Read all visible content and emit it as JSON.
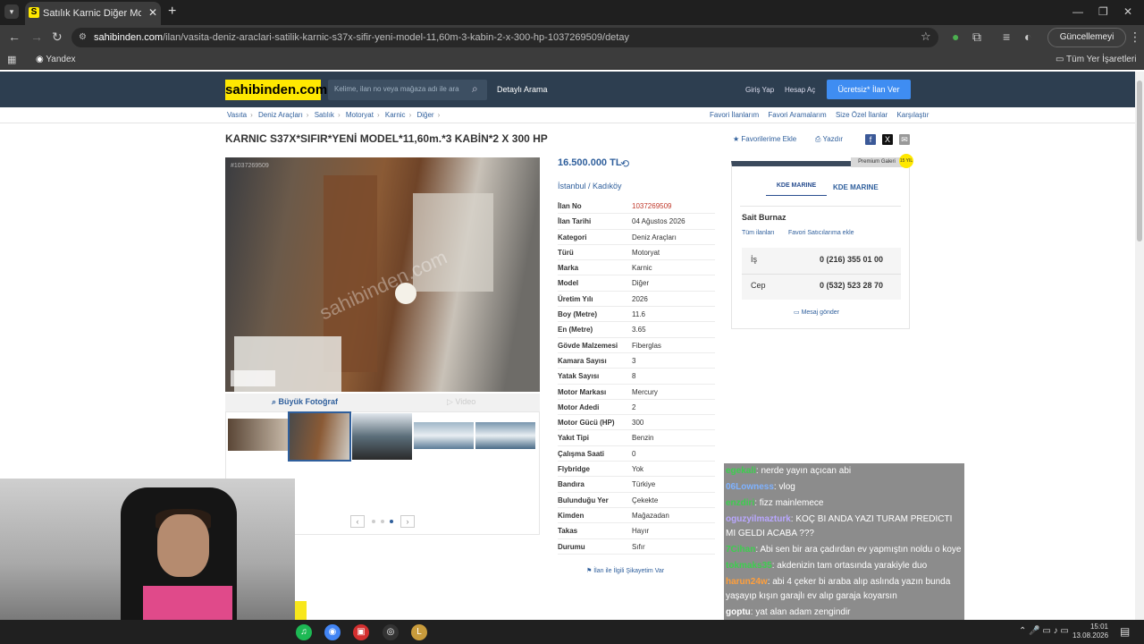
{
  "browser": {
    "tab_title": "Satılık Karnic Diğer Motoryat -",
    "tab_close": "✕",
    "new_tab": "+",
    "url_domain": "sahibinden.com",
    "url_path": "/ilan/vasita-deniz-araclari-satilik-karnic-s37x-sifir-yeni-model-11,60m-3-kabin-2-x-300-hp-1037269509/detay",
    "update_button": "Güncellemeyi tamamla",
    "bookmark_left": "Yandex",
    "bookmark_right": "Tüm Yer İşaretleri"
  },
  "site": {
    "logo": "sahibinden.com",
    "search_placeholder": "Kelime, ilan no veya mağaza adı ile ara",
    "detailed_search": "Detaylı Arama",
    "login": "Giriş Yap",
    "register": "Hesap Aç",
    "post_ad": "Ücretsiz* İlan Ver"
  },
  "breadcrumb": [
    "Vasıta",
    "Deniz Araçları",
    "Satılık",
    "Motoryat",
    "Karnic",
    "Diğer"
  ],
  "top_links": [
    "Favori İlanlarım",
    "Favori Aramalarım",
    "Size Özel İlanlar",
    "Karşılaştır"
  ],
  "listing": {
    "title": "KARNIC S37X*SIFIR*YENİ MODEL*11,60m.*3 KABİN*2 X 300 HP",
    "add_favorite": "Favorilerime Ekle",
    "print": "Yazdır",
    "price": "16.500.000 TL",
    "location": "İstanbul  /  Kadıköy",
    "big_photo": "Büyük Fotoğraf",
    "video": "Video",
    "photo_watermark": "sahibinden.com",
    "photo_id": "#1037269509",
    "complaint": "İlan ile İlgili Şikayetim Var",
    "details": [
      {
        "k": "İlan No",
        "v": "1037269509",
        "red": true
      },
      {
        "k": "İlan Tarihi",
        "v": "04 Ağustos 2026"
      },
      {
        "k": "Kategori",
        "v": "Deniz Araçları"
      },
      {
        "k": "Türü",
        "v": "Motoryat"
      },
      {
        "k": "Marka",
        "v": "Karnic"
      },
      {
        "k": "Model",
        "v": "Diğer"
      },
      {
        "k": "Üretim Yılı",
        "v": "2026"
      },
      {
        "k": "Boy (Metre)",
        "v": "11.6"
      },
      {
        "k": "En (Metre)",
        "v": "3.65"
      },
      {
        "k": "Gövde Malzemesi",
        "v": "Fiberglas"
      },
      {
        "k": "Kamara Sayısı",
        "v": "3"
      },
      {
        "k": "Yatak Sayısı",
        "v": "8"
      },
      {
        "k": "Motor Markası",
        "v": "Mercury"
      },
      {
        "k": "Motor Adedi",
        "v": "2"
      },
      {
        "k": "Motor Gücü (HP)",
        "v": "300"
      },
      {
        "k": "Yakıt Tipi",
        "v": "Benzin"
      },
      {
        "k": "Çalışma Saati",
        "v": "0"
      },
      {
        "k": "Flybridge",
        "v": "Yok"
      },
      {
        "k": "Bandıra",
        "v": "Türkiye"
      },
      {
        "k": "Bulunduğu Yer",
        "v": "Çekekte"
      },
      {
        "k": "Kimden",
        "v": "Mağazadan"
      },
      {
        "k": "Takas",
        "v": "Hayır"
      },
      {
        "k": "Durumu",
        "v": "Sıfır"
      }
    ]
  },
  "seller": {
    "premium": "Premium Galeri",
    "premium_years": "15 YIL",
    "logo_text": "KDE MARINE",
    "store_name": "KDE MARINE",
    "person": "Sait Burnaz",
    "all_ads": "Tüm ilanları",
    "fav_seller": "Favori Satıcılarıma ekle",
    "phones": [
      {
        "label": "İş",
        "value": "0 (216) 355 01 00"
      },
      {
        "label": "Cep",
        "value": "0 (532) 523 28 70"
      }
    ],
    "message": "Mesaj gönder"
  },
  "chat": [
    {
      "user": "egekali",
      "color": "#3ccf4e",
      "text": ": nerde yayın açıcan abi"
    },
    {
      "user": "06Lowness",
      "color": "#7fb2ff",
      "text": ": vlog"
    },
    {
      "user": "enzdiri",
      "color": "#3ccf4e",
      "text": ": fizz mainlemece"
    },
    {
      "user": "oguzyilmazturk",
      "color": "#b9a7ff",
      "text": ": KOÇ BI ANDA YAZI TURAM PREDICTI MI GELDI ACABA ???"
    },
    {
      "user": "7Cihan",
      "color": "#3ccf4e",
      "text": ": Abi sen bir ara çadırdan ev yapmıştın noldu o koye"
    },
    {
      "user": "tokmaks35",
      "color": "#3ccf4e",
      "text": ": akdenizin tam ortasında yarakiyle duo"
    },
    {
      "user": "harun24w",
      "color": "#ff9f3c",
      "text": ": abi 4 çeker bi araba alıp aslında yazın bunda yaşayıp kışın garajlı ev alıp garaja koyarsın"
    },
    {
      "user": "goptu",
      "color": "#ffffff",
      "text": ": yat alan adam zengindir"
    }
  ],
  "taskbar": {
    "time": "15:01",
    "date": "13.08.2026"
  }
}
